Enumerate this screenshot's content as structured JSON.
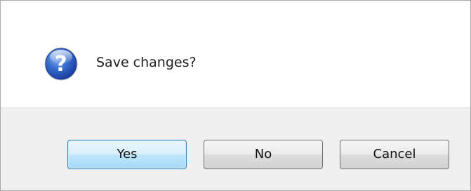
{
  "dialog": {
    "message": "Save changes?",
    "icon": "question-icon",
    "buttons": {
      "yes_label": "Yes",
      "no_label": "No",
      "cancel_label": "Cancel"
    }
  },
  "colors": {
    "footer_background": "#f0f0f0",
    "default_button_border": "#3c7fb1",
    "icon_blue": "#2a5bb5"
  }
}
